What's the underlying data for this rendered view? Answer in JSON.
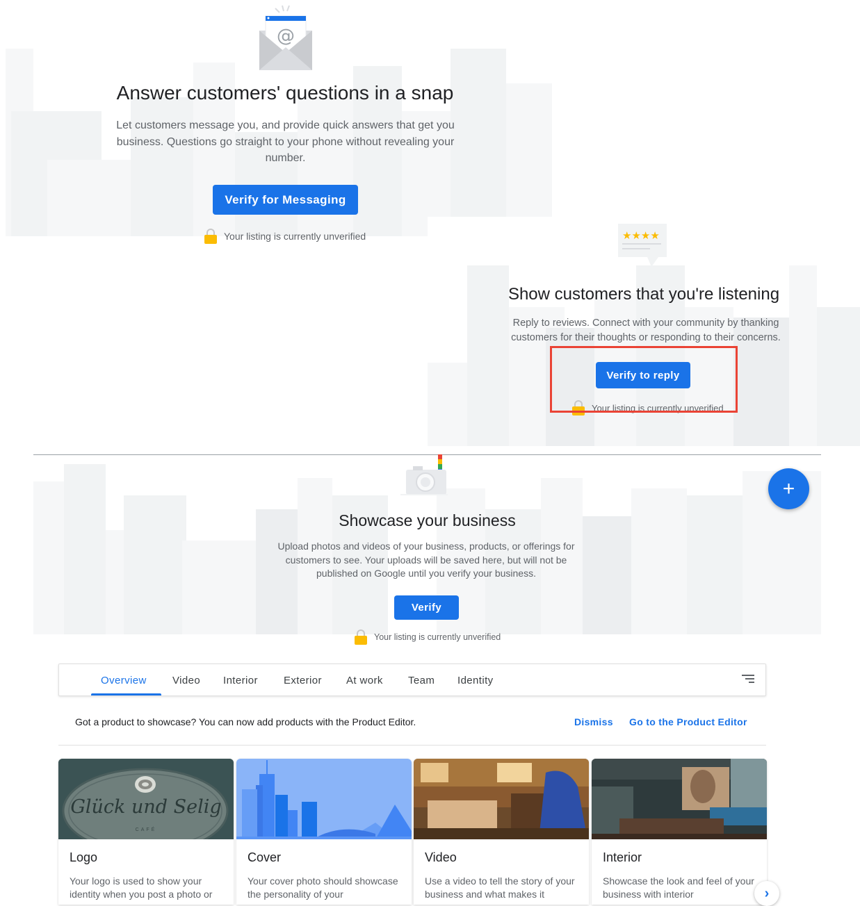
{
  "messaging": {
    "title": "Answer customers' questions in a snap",
    "description": "Let customers message you, and provide quick answers that get you business. Questions go straight to your phone without revealing your number.",
    "button_label": "Verify for Messaging",
    "status": "Your listing is currently unverified"
  },
  "reviews": {
    "title": "Show customers that you're listening",
    "description": "Reply to reviews. Connect with your community by thanking customers for their thoughts or responding to their concerns.",
    "button_label": "Verify to reply",
    "status": "Your listing is currently unverified"
  },
  "photos": {
    "title": "Showcase your business",
    "description": "Upload photos and videos of your business, products, or offerings for customers to see. Your uploads will be saved here, but will not be published on Google until you verify your business.",
    "button_label": "Verify",
    "status": "Your listing is currently unverified",
    "fab_label": "+"
  },
  "tabs": [
    {
      "label": "Overview",
      "active": true
    },
    {
      "label": "Video"
    },
    {
      "label": "Interior"
    },
    {
      "label": "Exterior"
    },
    {
      "label": "At work"
    },
    {
      "label": "Team"
    },
    {
      "label": "Identity"
    }
  ],
  "product_notice": {
    "text": "Got a product to showcase? You can now add products with the Product Editor.",
    "dismiss": "Dismiss",
    "editor_link": "Go to the Product Editor"
  },
  "cards": [
    {
      "title": "Logo",
      "description": "Your logo is used to show your identity when you post a photo or",
      "logo_text": "Glück und Selig",
      "logo_sub": "CAFÉ"
    },
    {
      "title": "Cover",
      "description": "Your cover photo should showcase the personality of your"
    },
    {
      "title": "Video",
      "description": "Use a video to tell the story of your business and what makes it"
    },
    {
      "title": "Interior",
      "description": "Showcase the look and feel of your business with interior"
    }
  ],
  "next_button": "›",
  "colors": {
    "primary": "#1a73e8",
    "highlight": "#ea4335",
    "lock": "#fbbc04"
  }
}
